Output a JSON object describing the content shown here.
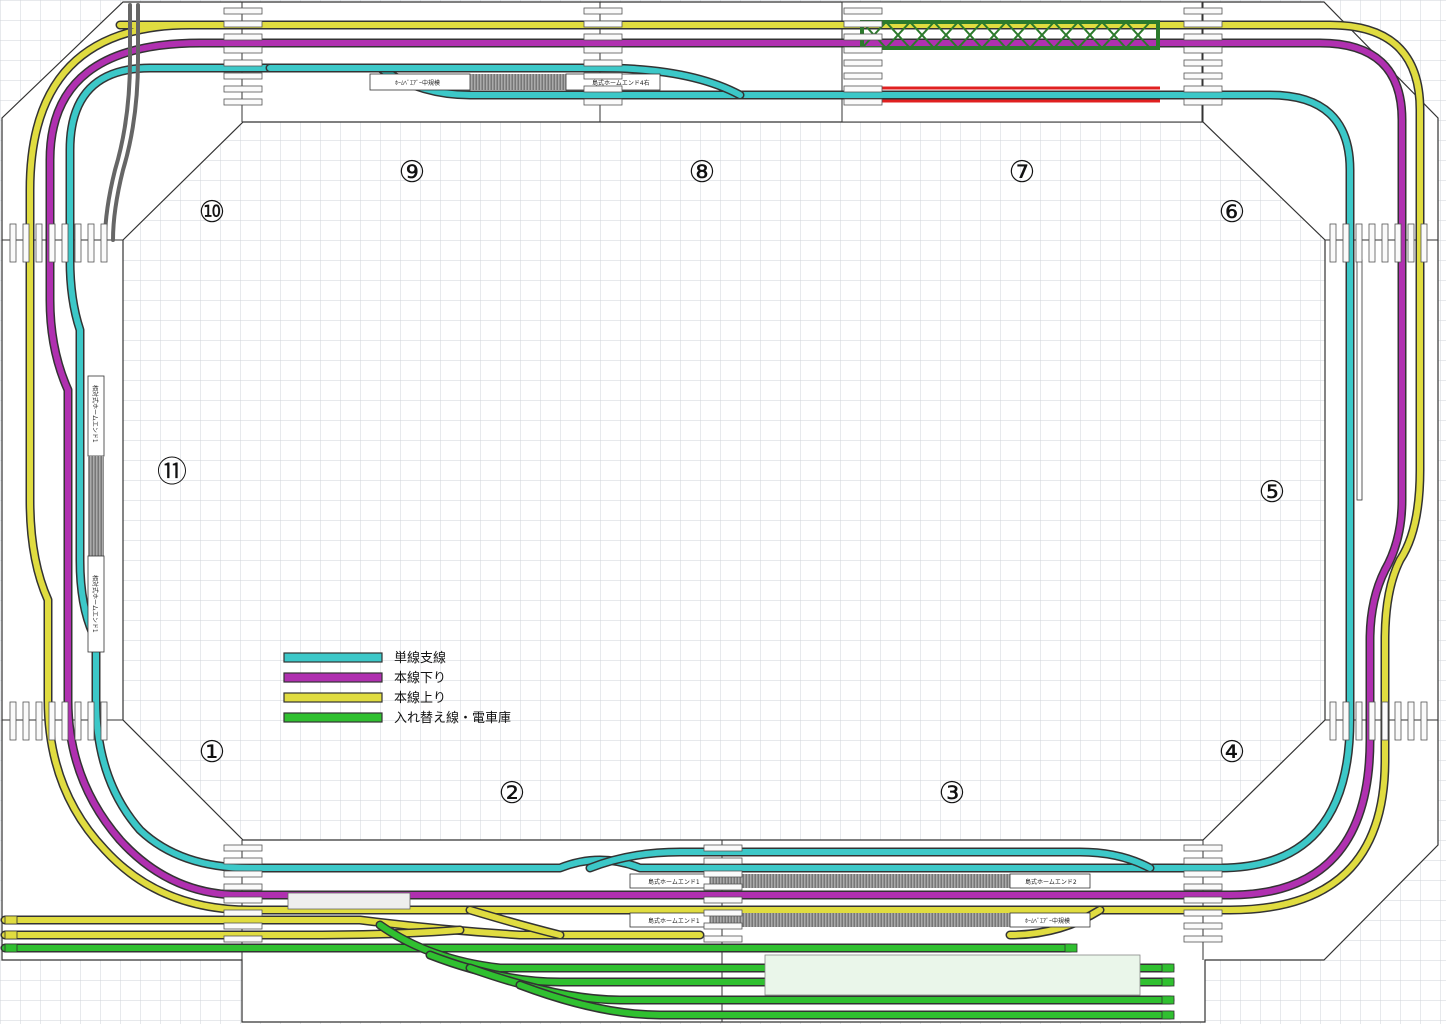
{
  "colors": {
    "branch": "#3cc8c8",
    "down": "#b030b0",
    "up": "#e0dc40",
    "yard": "#30c030",
    "board": "#ffffff",
    "grid": "#cfd3d8",
    "outline": "#333333",
    "platform": "#8a8a8a",
    "bridge": "#2c7a2c",
    "redtrack": "#e02020"
  },
  "legend": [
    {
      "key": "branch",
      "label": "単線支線"
    },
    {
      "key": "down",
      "label": "本線下り"
    },
    {
      "key": "up",
      "label": "本線上り"
    },
    {
      "key": "yard",
      "label": "入れ替え線・電車庫"
    }
  ],
  "sections": [
    {
      "id": "s1",
      "label": "①"
    },
    {
      "id": "s2",
      "label": "②"
    },
    {
      "id": "s3",
      "label": "③"
    },
    {
      "id": "s4",
      "label": "④"
    },
    {
      "id": "s5",
      "label": "⑤"
    },
    {
      "id": "s6",
      "label": "⑥"
    },
    {
      "id": "s7",
      "label": "⑦"
    },
    {
      "id": "s8",
      "label": "⑧"
    },
    {
      "id": "s9",
      "label": "⑨"
    },
    {
      "id": "s10",
      "label": "⑩"
    },
    {
      "id": "s11",
      "label": "⑪"
    }
  ],
  "platform_labels": {
    "top_left": "ﾎｰﾑﾍﾞｴｱﾞｰ中規模",
    "top_right": "島式ホームエンド4右",
    "bottom_a": "島式ホームエンド1",
    "bottom_b": "島式ホームエンド1",
    "bottom_c": "島式ホームエンド2",
    "bottom_d": "ﾎｰﾑﾍﾞｴｱﾞｰ中規模",
    "left_a": "相対式ホームエンド1",
    "left_b": "相対式ホームエンド1"
  }
}
